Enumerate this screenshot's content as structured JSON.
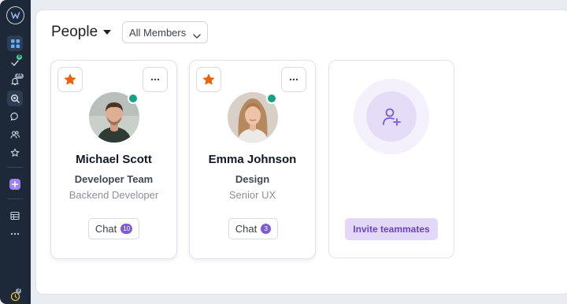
{
  "sidebar": {
    "badges": {
      "activity": "8",
      "notifications": "28",
      "timer": "3"
    },
    "icons": [
      "logo-icon",
      "grid-icon",
      "activity-icon",
      "bell-icon",
      "search-icon",
      "chat-icon",
      "people-icon",
      "star-icon",
      "plus-icon",
      "table-icon",
      "more-icon",
      "timer-icon"
    ]
  },
  "header": {
    "title": "People",
    "filter": "All Members"
  },
  "people": [
    {
      "name": "Michael Scott",
      "team": "Developer Team",
      "role": "Backend Developer",
      "chat_label": "Chat",
      "chat_count": "10"
    },
    {
      "name": "Emma Johnson",
      "team": "Design",
      "role": "Senior UX",
      "chat_label": "Chat",
      "chat_count": "3"
    }
  ],
  "invite": {
    "label": "Invite teammates"
  },
  "colors": {
    "sidebar": "#1d2939",
    "accent": "#7d5bd6",
    "online": "#12a482",
    "star": "#e8650a"
  }
}
